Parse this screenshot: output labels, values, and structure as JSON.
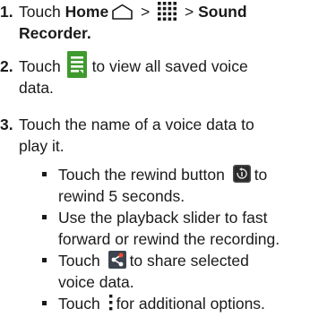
{
  "steps": [
    {
      "number": "1.",
      "line1_prefix": "Touch ",
      "home_label": "Home",
      "sep1": " > ",
      "sep2": " > ",
      "sound_label": "Sound",
      "line2": "Recorder."
    },
    {
      "number": "2.",
      "line1_prefix": "Touch ",
      "line1_suffix": "to view all saved voice",
      "line2": "data."
    },
    {
      "number": "3.",
      "line1": "Touch the name of a voice data to",
      "line2": "play it."
    }
  ],
  "bullets": [
    {
      "line1_prefix": "Touch the rewind button ",
      "line1_suffix": "to",
      "line2": "rewind 5 seconds."
    },
    {
      "line1": "Use the playback slider to fast",
      "line2": "forward or rewind the recording."
    },
    {
      "line1_prefix": "Touch ",
      "line1_suffix": "to share selected",
      "line2": "voice data."
    },
    {
      "line1_prefix": "Touch ",
      "line1_suffix": "for additional options."
    }
  ],
  "icons": {
    "home": "home-outline-icon",
    "apps": "app-grid-icon",
    "list": "voice-list-icon",
    "rewind": "rewind-icon",
    "share": "share-icon",
    "menu": "menu-dots-icon"
  },
  "colors": {
    "text": "#1a1a1a",
    "list_icon": "#3f9a2e",
    "share_icon_bg": "#3d4450",
    "share_icon_arrow": "#ff4b2e"
  }
}
